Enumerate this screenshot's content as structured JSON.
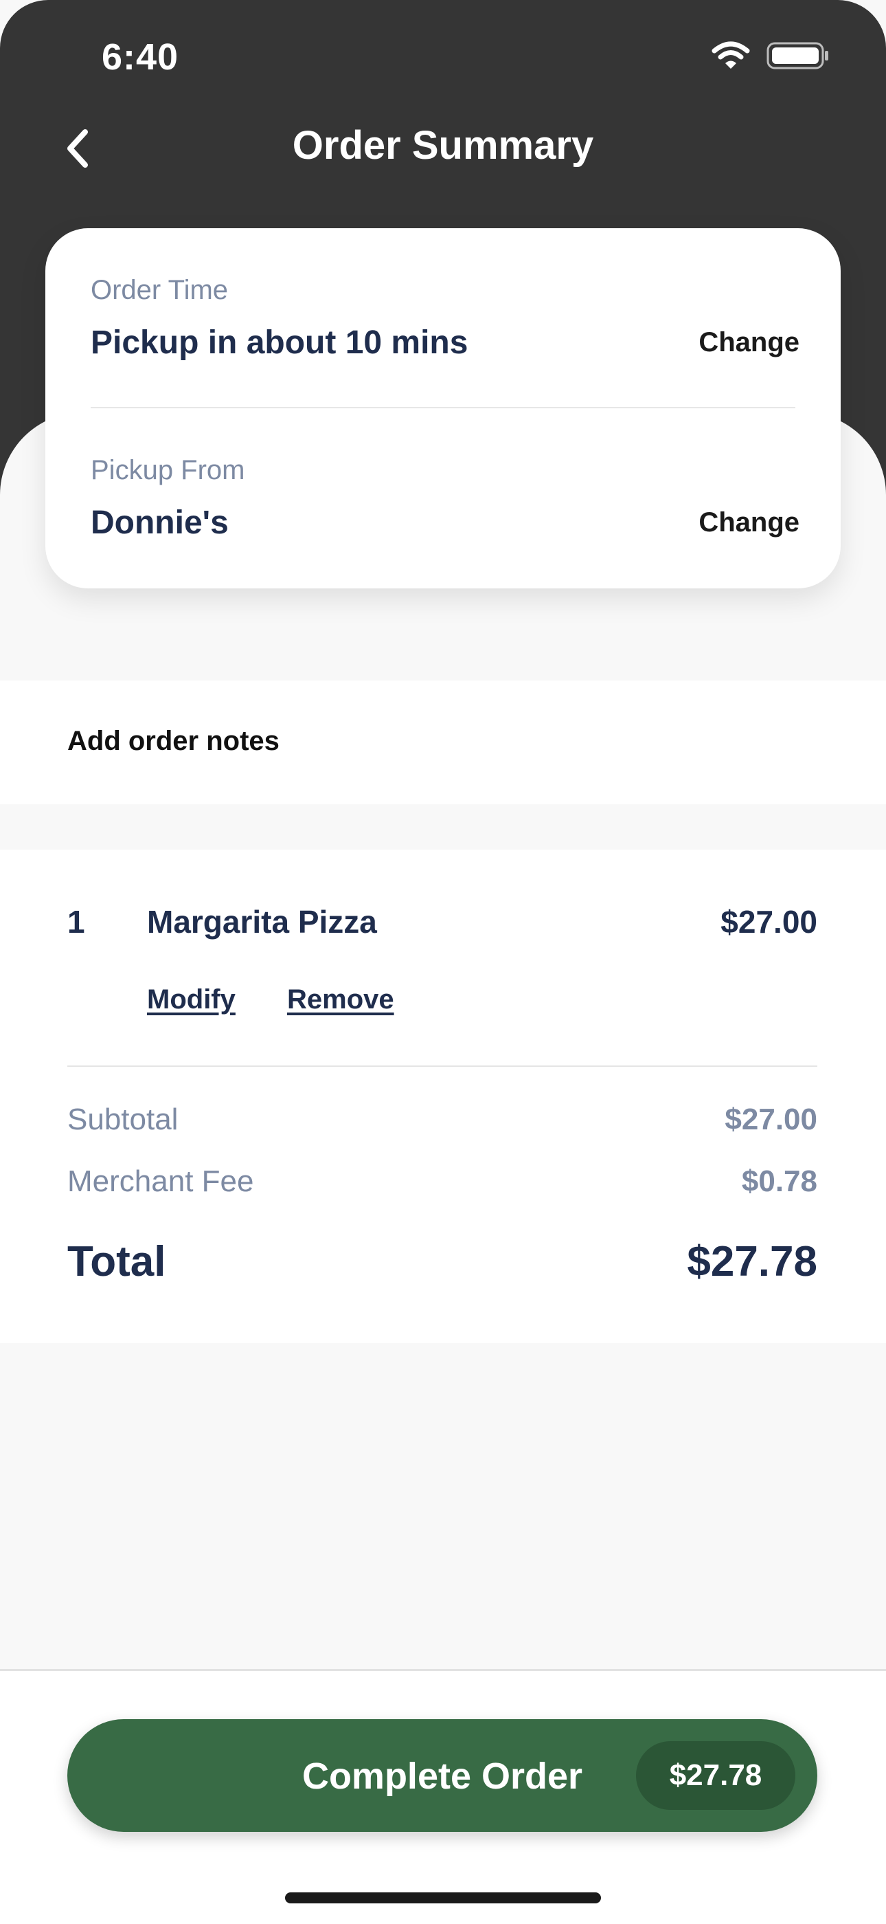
{
  "status_bar": {
    "time": "6:40",
    "icons": [
      "wifi-icon",
      "battery-icon"
    ]
  },
  "header": {
    "title": "Order Summary",
    "back_icon": "chevron-left-icon"
  },
  "order_card": {
    "order_time": {
      "label": "Order Time",
      "value": "Pickup in about 10 mins",
      "action": "Change"
    },
    "pickup_from": {
      "label": "Pickup From",
      "value": "Donnie's",
      "action": "Change"
    }
  },
  "notes": {
    "label": "Add order notes"
  },
  "items": [
    {
      "qty": "1",
      "name": "Margarita Pizza",
      "price": "$27.00",
      "actions": [
        "Modify",
        "Remove"
      ]
    }
  ],
  "summary": {
    "subtotal": {
      "label": "Subtotal",
      "value": "$27.00"
    },
    "merchant_fee": {
      "label": "Merchant Fee",
      "value": "$0.78"
    },
    "total": {
      "label": "Total",
      "value": "$27.78"
    }
  },
  "cta": {
    "label": "Complete Order",
    "price": "$27.78"
  },
  "colors": {
    "header_bg": "#353535",
    "accent_green": "#386b45",
    "text_navy": "#1f2d4d",
    "label_gray": "#7d8aa3"
  }
}
